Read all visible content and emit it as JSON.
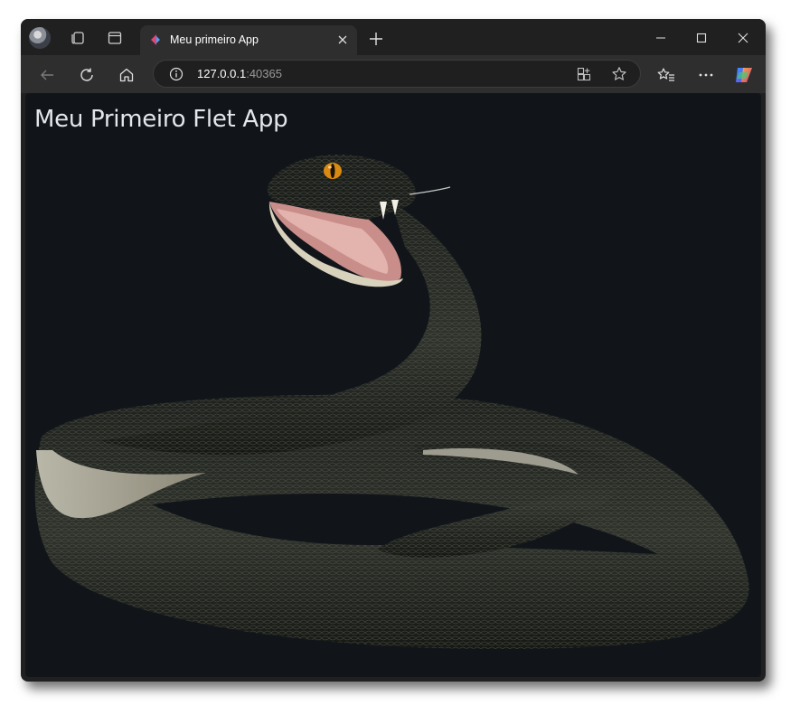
{
  "browser": {
    "tab": {
      "title": "Meu primeiro App"
    },
    "address": {
      "host": "127.0.0.1",
      "port": ":40365"
    }
  },
  "page": {
    "heading": "Meu Primeiro Flet App",
    "image": {
      "subject": "snake",
      "icon": "snake-image"
    }
  },
  "colors": {
    "page_background": "#11151a",
    "tab_strip": "#202020",
    "toolbar": "#2e2e2e",
    "heading_text": "#e3e6ea"
  }
}
